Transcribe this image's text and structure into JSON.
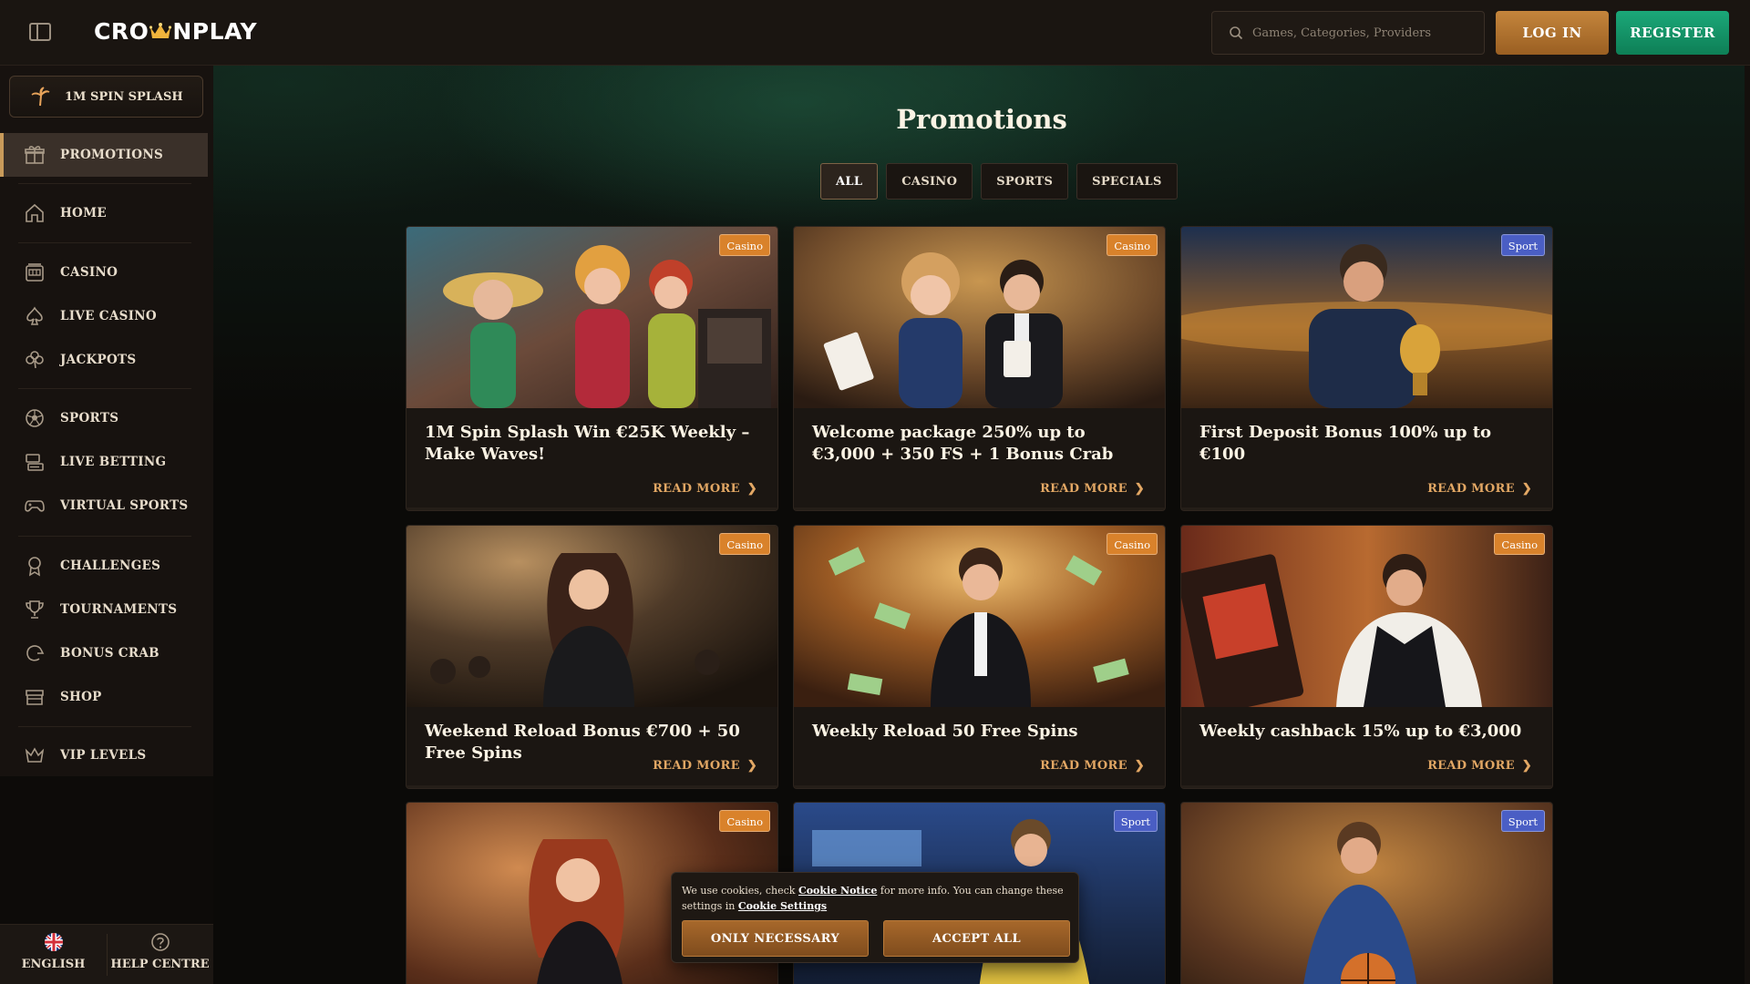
{
  "header": {
    "logo_part1": "CRO",
    "logo_part2": "NPLAY",
    "search_placeholder": "Games, Categories, Providers",
    "login_label": "LOG IN",
    "register_label": "REGISTER"
  },
  "sidebar": {
    "spin_splash_label": "1M SPIN SPLASH",
    "items": [
      {
        "label": "PROMOTIONS",
        "icon": "gift-icon",
        "active": true
      },
      {
        "label": "HOME",
        "icon": "home-icon"
      },
      {
        "label": "CASINO",
        "icon": "slot-machine-icon"
      },
      {
        "label": "LIVE CASINO",
        "icon": "spade-icon"
      },
      {
        "label": "JACKPOTS",
        "icon": "clover-icon"
      },
      {
        "label": "SPORTS",
        "icon": "soccer-ball-icon"
      },
      {
        "label": "LIVE BETTING",
        "icon": "live-betting-icon"
      },
      {
        "label": "VIRTUAL SPORTS",
        "icon": "gamepad-icon"
      },
      {
        "label": "CHALLENGES",
        "icon": "medal-icon"
      },
      {
        "label": "TOURNAMENTS",
        "icon": "trophy-icon"
      },
      {
        "label": "BONUS CRAB",
        "icon": "crab-icon"
      },
      {
        "label": "SHOP",
        "icon": "shop-icon"
      },
      {
        "label": "VIP LEVELS",
        "icon": "crown-icon"
      }
    ],
    "language_label": "ENGLISH",
    "help_label": "HELP CENTRE"
  },
  "main": {
    "title": "Promotions",
    "tabs": [
      "ALL",
      "CASINO",
      "SPORTS",
      "SPECIALS"
    ],
    "active_tab": "ALL",
    "read_more_label": "READ MORE",
    "cards": [
      {
        "title": "1M Spin Splash Win €25K Weekly – Make Waves!",
        "badge": "Casino"
      },
      {
        "title": "Welcome package 250% up to €3,000 + 350 FS + 1 Bonus Crab",
        "badge": "Casino"
      },
      {
        "title": "First Deposit Bonus 100% up to €100",
        "badge": "Sport"
      },
      {
        "title": "Weekend Reload Bonus €700 + 50 Free Spins",
        "badge": "Casino"
      },
      {
        "title": "Weekly Reload 50 Free Spins",
        "badge": "Casino"
      },
      {
        "title": "Weekly cashback 15% up to €3,000",
        "badge": "Casino"
      },
      {
        "title": "",
        "badge": "Casino"
      },
      {
        "title": "",
        "badge": "Sport"
      },
      {
        "title": "",
        "badge": "Sport"
      }
    ]
  },
  "cookie": {
    "text_1": "We use cookies, check ",
    "link_1": "Cookie Notice",
    "text_2": " for more info. You can change these settings in ",
    "link_2": "Cookie Settings",
    "only_necessary_label": "ONLY NECESSARY",
    "accept_all_label": "ACCEPT ALL"
  },
  "colors": {
    "accent_gold": "#c4853c",
    "register_green": "#1ba879",
    "casino_badge": "#d9822b",
    "sport_badge": "#4a5ec4",
    "read_more": "#e2a764"
  }
}
